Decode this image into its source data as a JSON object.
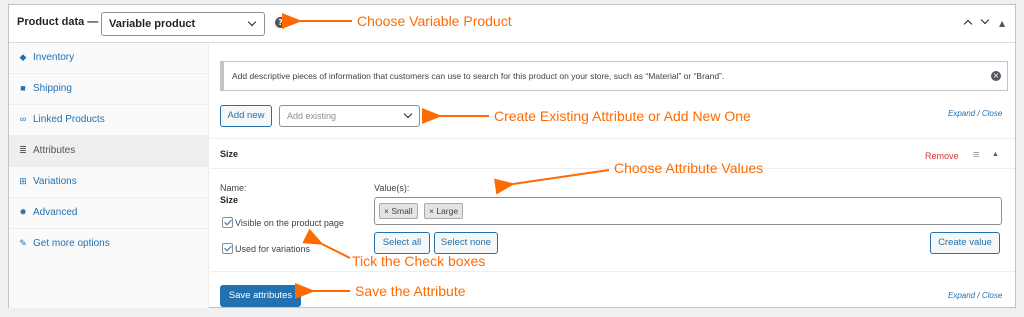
{
  "header": {
    "title": "Product data —",
    "product_type": "Variable product",
    "help": "?"
  },
  "sidebar": {
    "items": [
      {
        "label": "Inventory",
        "icon": "tag-icon"
      },
      {
        "label": "Shipping",
        "icon": "truck-icon"
      },
      {
        "label": "Linked Products",
        "icon": "link-icon"
      },
      {
        "label": "Attributes",
        "icon": "list-icon"
      },
      {
        "label": "Variations",
        "icon": "grid-icon"
      },
      {
        "label": "Advanced",
        "icon": "gear-icon"
      },
      {
        "label": "Get more options",
        "icon": "plugin-icon"
      }
    ]
  },
  "notice": {
    "text": "Add descriptive pieces of information that customers can use to search for this product on your store, such as “Material” or “Brand”."
  },
  "toolbar": {
    "add_new": "Add new",
    "add_existing_placeholder": "Add existing",
    "expand": "Expand",
    "sep": "/",
    "close": "Close"
  },
  "attribute": {
    "title": "Size",
    "remove": "Remove",
    "name_label": "Name:",
    "name_value": "Size",
    "values_label": "Value(s):",
    "values": [
      "Small",
      "Large"
    ],
    "visible_label": "Visible on the product page",
    "variations_label": "Used for variations",
    "select_all": "Select all",
    "select_none": "Select none",
    "create_value": "Create value"
  },
  "footer": {
    "save": "Save attributes"
  },
  "annotations": {
    "choose_variable": "Choose Variable Product",
    "create_existing": "Create Existing Attribute or Add New One",
    "choose_values": "Choose Attribute Values",
    "tick_boxes": "Tick the Check boxes",
    "save_attribute": "Save the Attribute"
  },
  "colors": {
    "accent": "#2271b1",
    "annotation": "#ff6a00",
    "remove": "#d63638"
  }
}
